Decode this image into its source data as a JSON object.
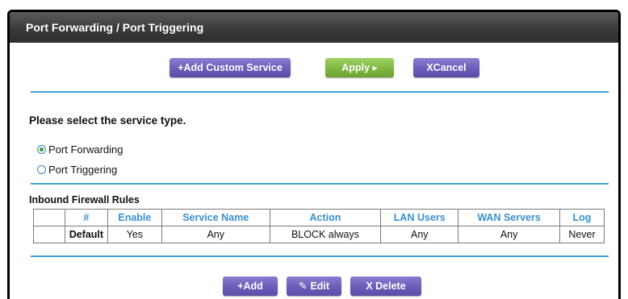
{
  "header": {
    "title": "Port Forwarding / Port Triggering"
  },
  "toolbar": {
    "add_custom_service": "+Add Custom Service",
    "apply": "Apply ▸",
    "cancel": "XCancel"
  },
  "service_type": {
    "prompt": "Please select the service type.",
    "options": [
      {
        "label": "Port Forwarding",
        "selected": true
      },
      {
        "label": "Port Triggering",
        "selected": false
      }
    ]
  },
  "firewall": {
    "heading": "Inbound Firewall Rules",
    "columns": [
      "#",
      "Enable",
      "Service Name",
      "Action",
      "LAN Users",
      "WAN Servers",
      "Log"
    ],
    "rows": [
      {
        "id": "Default",
        "enable": "Yes",
        "service": "Any",
        "action": "BLOCK always",
        "lan": "Any",
        "wan": "Any",
        "log": "Never"
      }
    ]
  },
  "row_actions": {
    "add": "+Add",
    "edit": "Edit",
    "delete": "X Delete"
  },
  "colors": {
    "accent_line": "#3fa0d8",
    "button_purple": "#6a5cb8",
    "button_green": "#7eb641",
    "header_link": "#3a8fcf"
  }
}
